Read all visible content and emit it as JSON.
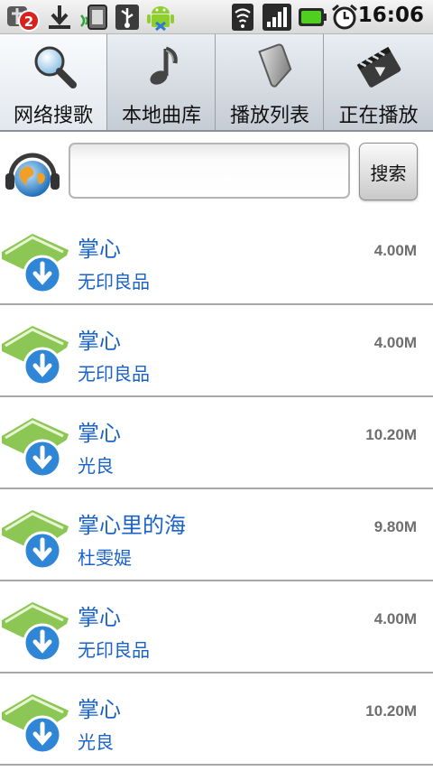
{
  "status_bar": {
    "notification_badge": "2",
    "time": "16:06",
    "icons": [
      "notification-badge-icon",
      "download-icon",
      "usb-storage-icon",
      "usb-icon",
      "android-icon",
      "wifi-icon",
      "signal-icon",
      "battery-icon",
      "alarm-icon"
    ]
  },
  "tabs": [
    {
      "label": "网络搜歌",
      "icon": "search-icon",
      "active": true
    },
    {
      "label": "本地曲库",
      "icon": "music-note-icon",
      "active": false
    },
    {
      "label": "播放列表",
      "icon": "playlist-icon",
      "active": false
    },
    {
      "label": "正在播放",
      "icon": "now-playing-icon",
      "active": false
    }
  ],
  "search": {
    "value": "",
    "placeholder": "",
    "button_label": "搜索"
  },
  "songs": [
    {
      "title": "掌心",
      "artist": "无印良品",
      "size": "4.00M"
    },
    {
      "title": "掌心",
      "artist": "无印良品",
      "size": "4.00M"
    },
    {
      "title": "掌心",
      "artist": "光良",
      "size": "10.20M"
    },
    {
      "title": "掌心里的海",
      "artist": "杜雯媞",
      "size": "9.80M"
    },
    {
      "title": "掌心",
      "artist": "无印良品",
      "size": "4.00M"
    },
    {
      "title": "掌心",
      "artist": "光良",
      "size": "10.20M"
    }
  ],
  "colors": {
    "title_blue": "#1a62cb",
    "size_gray": "#6e6e6e",
    "battery_green": "#4fcf1f"
  }
}
